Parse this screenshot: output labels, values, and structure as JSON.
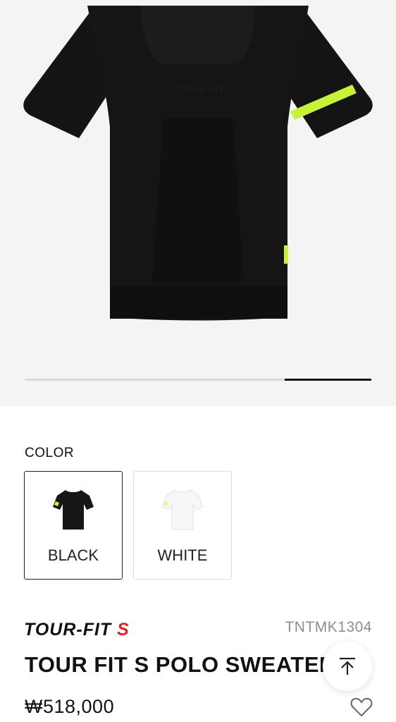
{
  "gallery": {
    "image_alt": "Black tour fit s polo sweater, back view",
    "progress_fraction": 0.25,
    "colors": {
      "garment": "#121212",
      "accent": "#c6f23a",
      "background": "#f4f4f4"
    }
  },
  "color_section": {
    "label": "COLOR",
    "options": [
      {
        "name": "BLACK",
        "selected": true,
        "swatch_color": "#161616"
      },
      {
        "name": "WHITE",
        "selected": false,
        "swatch_color": "#f7f7f7"
      }
    ]
  },
  "product": {
    "brand": "TOUR-FIT S",
    "brand_accent_color": "#d9262d",
    "code": "TNTMK1304",
    "name": "TOUR FIT S POLO SWEATER",
    "price": "₩518,000"
  },
  "icons": {
    "scroll_top": "arrow-up-to-top-icon",
    "wishlist": "heart-outline-icon"
  }
}
